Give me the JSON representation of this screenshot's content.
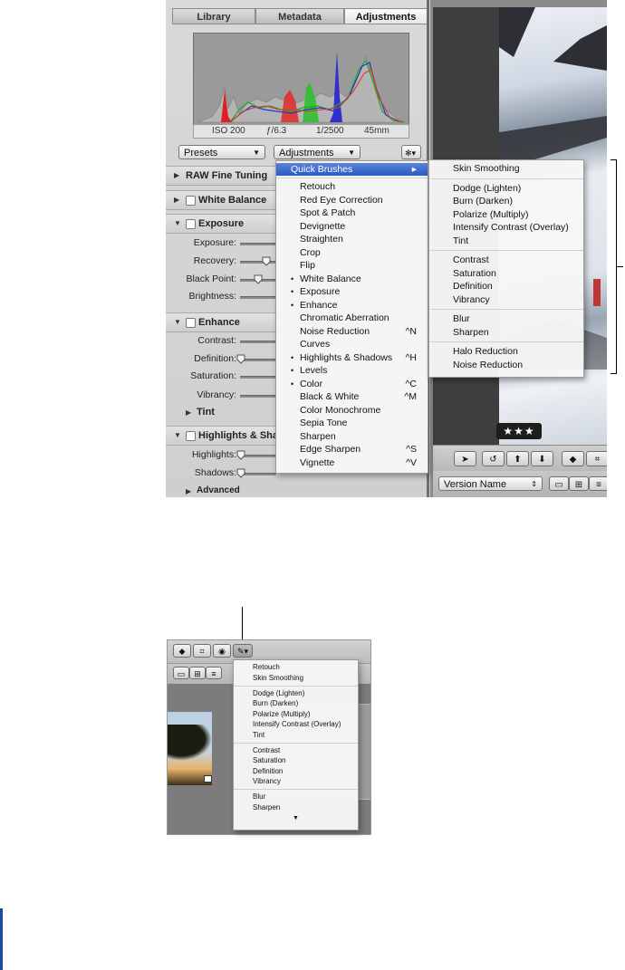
{
  "inspector": {
    "tabs": [
      "Library",
      "Metadata",
      "Adjustments"
    ],
    "selected_tab": "Adjustments",
    "exif": {
      "iso": "ISO 200",
      "aperture": "ƒ/6.3",
      "shutter": "1/2500",
      "focal": "45mm"
    },
    "presets_label": "Presets",
    "adjustments_label": "Adjustments",
    "gear_label": "✻▾",
    "sections": {
      "raw": "RAW Fine Tuning",
      "white_balance": "White Balance",
      "exposure": "Exposure",
      "enhance": "Enhance",
      "tint": "Tint",
      "highlights": "Highlights & Sha",
      "advanced": "Advanced"
    },
    "sliders": {
      "exposure": "Exposure:",
      "recovery": "Recovery:",
      "black_point": "Black Point:",
      "brightness": "Brightness:",
      "contrast": "Contrast:",
      "definition": "Definition:",
      "saturation": "Saturation:",
      "vibrancy": "Vibrancy:",
      "highlights": "Highlights:",
      "shadows": "Shadows:"
    }
  },
  "adjustments_menu": {
    "items": [
      {
        "label": "Quick Brushes",
        "shortcut": "▸",
        "checked": false,
        "highlighted": true
      },
      {
        "label": "Retouch",
        "shortcut": "",
        "checked": false
      },
      {
        "label": "Red Eye Correction",
        "shortcut": "",
        "checked": false
      },
      {
        "label": "Spot & Patch",
        "shortcut": "",
        "checked": false
      },
      {
        "label": "Devignette",
        "shortcut": "",
        "checked": false
      },
      {
        "label": "Straighten",
        "shortcut": "",
        "checked": false
      },
      {
        "label": "Crop",
        "shortcut": "",
        "checked": false
      },
      {
        "label": "Flip",
        "shortcut": "",
        "checked": false
      },
      {
        "label": "White Balance",
        "shortcut": "",
        "checked": true
      },
      {
        "label": "Exposure",
        "shortcut": "",
        "checked": true
      },
      {
        "label": "Enhance",
        "shortcut": "",
        "checked": true
      },
      {
        "label": "Chromatic Aberration",
        "shortcut": "",
        "checked": false
      },
      {
        "label": "Noise Reduction",
        "shortcut": "^N",
        "checked": false
      },
      {
        "label": "Curves",
        "shortcut": "",
        "checked": false
      },
      {
        "label": "Highlights & Shadows",
        "shortcut": "^H",
        "checked": true
      },
      {
        "label": "Levels",
        "shortcut": "",
        "checked": true
      },
      {
        "label": "Color",
        "shortcut": "^C",
        "checked": true
      },
      {
        "label": "Black & White",
        "shortcut": "^M",
        "checked": false
      },
      {
        "label": "Color Monochrome",
        "shortcut": "",
        "checked": false
      },
      {
        "label": "Sepia Tone",
        "shortcut": "",
        "checked": false
      },
      {
        "label": "Sharpen",
        "shortcut": "",
        "checked": false
      },
      {
        "label": "Edge Sharpen",
        "shortcut": "^S",
        "checked": false
      },
      {
        "label": "Vignette",
        "shortcut": "^V",
        "checked": false
      }
    ]
  },
  "quick_brushes_menu": {
    "groups": [
      [
        "Skin Smoothing"
      ],
      [
        "Dodge (Lighten)",
        "Burn (Darken)",
        "Polarize (Multiply)",
        "Intensify Contrast (Overlay)",
        "Tint"
      ],
      [
        "Contrast",
        "Saturation",
        "Definition",
        "Vibrancy"
      ],
      [
        "Blur",
        "Sharpen"
      ],
      [
        "Halo Reduction",
        "Noise Reduction"
      ]
    ]
  },
  "viewer": {
    "rating": "★★★",
    "version_name": "Version Name"
  },
  "brush_popup_menu": {
    "groups": [
      [
        "Retouch",
        "Skin Smoothing"
      ],
      [
        "Dodge (Lighten)",
        "Burn (Darken)",
        "Polarize (Multiply)",
        "Intensify Contrast (Overlay)",
        "Tint"
      ],
      [
        "Contrast",
        "Saturation",
        "Definition",
        "Vibrancy"
      ],
      [
        "Blur",
        "Sharpen"
      ]
    ],
    "scroll_arrow": "▼"
  },
  "colors": {
    "menu_highlight": "#3a66cc",
    "accent_bar": "#1e4aa0"
  }
}
